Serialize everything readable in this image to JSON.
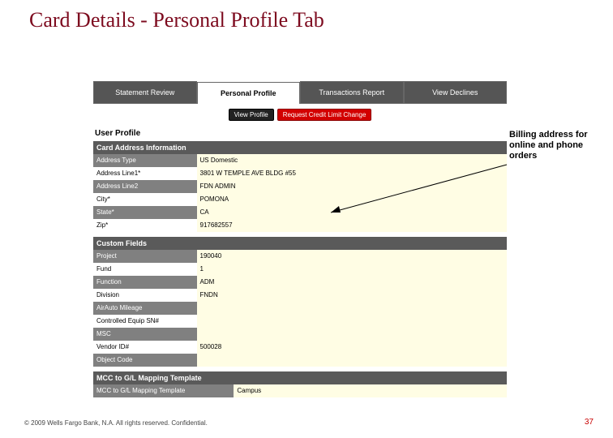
{
  "title": "Card Details - Personal Profile Tab",
  "tabs": {
    "statement": "Statement Review",
    "profile": "Personal Profile",
    "transactions": "Transactions Report",
    "declines": "View Declines"
  },
  "buttons": {
    "view_profile": "View Profile",
    "request_limit": "Request Credit Limit Change"
  },
  "user_profile_heading": "User Profile",
  "address": {
    "section": "Card Address Information",
    "rows": {
      "type_label": "Address Type",
      "type_value": "US Domestic",
      "line1_label": "Address Line1*",
      "line1_value": "3801 W TEMPLE AVE BLDG #55",
      "line2_label": "Address Line2",
      "line2_value": "FDN ADMIN",
      "city_label": "City*",
      "city_value": "POMONA",
      "state_label": "State*",
      "state_value": "CA",
      "zip_label": "Zip*",
      "zip_value": "917682557"
    }
  },
  "custom": {
    "section": "Custom Fields",
    "rows": {
      "project_label": "Project",
      "project_value": "190040",
      "fund_label": "Fund",
      "fund_value": "1",
      "function_label": "Function",
      "function_value": "ADM",
      "division_label": "Division",
      "division_value": "FNDN",
      "mileage_label": "AirAuto Mileage",
      "mileage_value": "",
      "equip_label": "Controlled Equip SN#",
      "equip_value": "",
      "msc_label": "MSC",
      "msc_value": "",
      "vendor_label": "Vendor ID#",
      "vendor_value": "500028",
      "object_label": "Object Code",
      "object_value": ""
    }
  },
  "mcc": {
    "section": "MCC to G/L Mapping Template",
    "row_label": "MCC to G/L Mapping Template",
    "row_value": "Campus"
  },
  "annotation": "Billing address for online and phone orders",
  "footer": "© 2009 Wells Fargo Bank, N.A. All rights reserved.  Confidential.",
  "page_number": "37"
}
